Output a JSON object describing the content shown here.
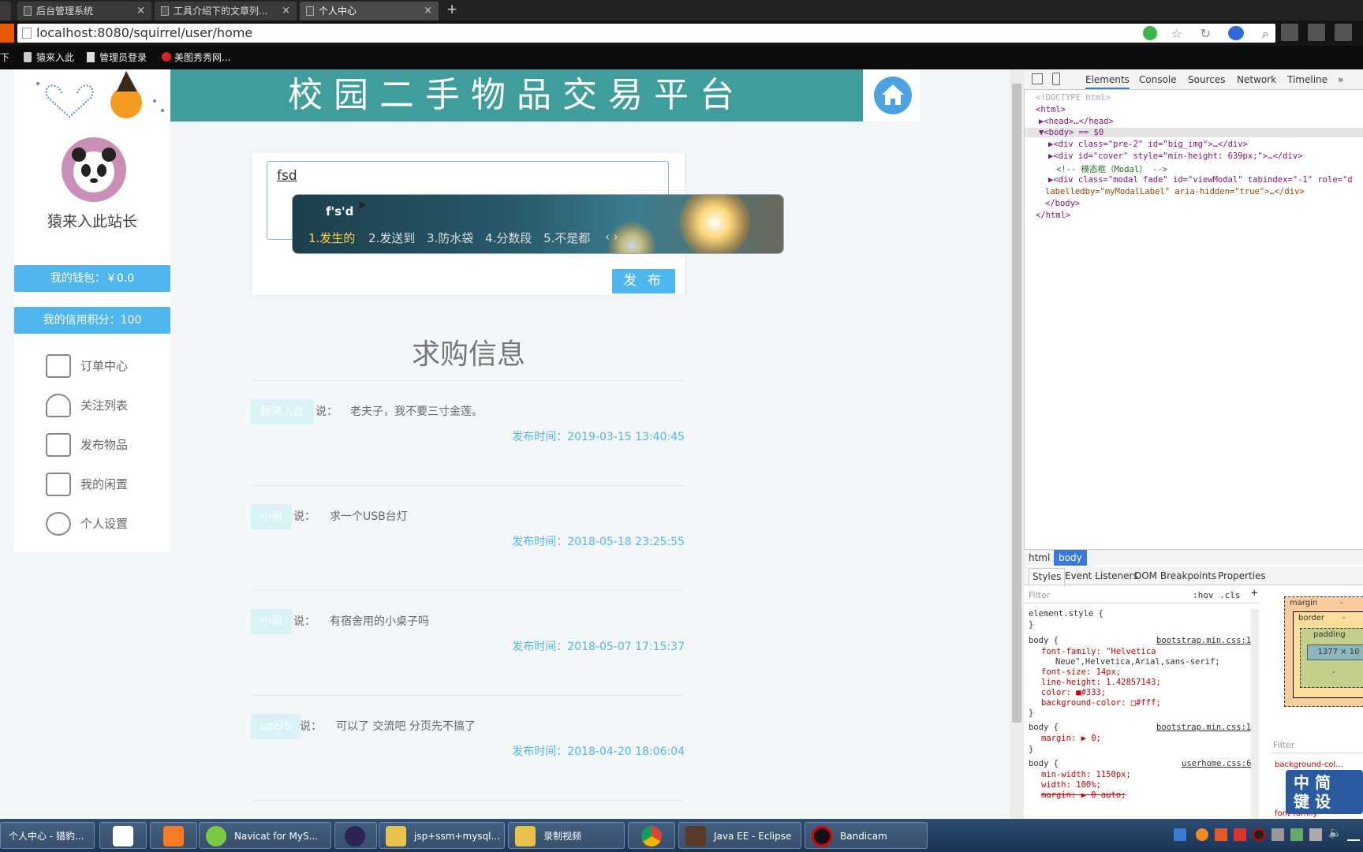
{
  "browser": {
    "tabs": [
      {
        "title": "后台管理系统",
        "active": false
      },
      {
        "title": "工具介绍下的文章列...",
        "active": false
      },
      {
        "title": "个人中心",
        "active": true
      }
    ],
    "new_tab": "+",
    "url": "localhost:8080/squirrel/user/home",
    "bookmarks": [
      "下",
      "猿来入此",
      "管理员登录",
      "美图秀秀网..."
    ]
  },
  "site": {
    "banner_title": "校园二手物品交易平台",
    "username": "猿来入此站长",
    "wallet": "我的钱包：￥0.0",
    "credit": "我的信用积分：100",
    "menu": [
      {
        "label": "订单中心",
        "icon": "envelope-icon"
      },
      {
        "label": "关注列表",
        "icon": "users-icon"
      },
      {
        "label": "发布物品",
        "icon": "bag-icon"
      },
      {
        "label": "我的闲置",
        "icon": "archive-icon"
      },
      {
        "label": "个人设置",
        "icon": "gear-icon"
      }
    ]
  },
  "post_form": {
    "input_value": "fsd",
    "submit_label": "发 布"
  },
  "ime": {
    "composition": "f's'd",
    "candidates": [
      "1.发生的",
      "2.发送到",
      "3.防水袋",
      "4.分数段",
      "5.不是都"
    ],
    "pager": "‹ ›"
  },
  "wanted": {
    "section_title": "求购信息",
    "says": "说：",
    "time_prefix": "发布时间：",
    "posts": [
      {
        "user": "猿来入此",
        "text": "老夫子，我不要三寸金莲。",
        "time": "2019-03-15 13:40:45"
      },
      {
        "user": "小丽",
        "text": "求一个USB台灯",
        "time": "2018-05-18 23:25:55"
      },
      {
        "user": "小丽",
        "text": "有宿舍用的小桌子吗",
        "time": "2018-05-07 17:15:37"
      },
      {
        "user": "user5",
        "text": "可以了 交流吧 分页先不搞了",
        "time": "2018-04-20 18:06:04"
      }
    ]
  },
  "devtools": {
    "tabs": [
      "Elements",
      "Console",
      "Sources",
      "Network",
      "Timeline",
      "»"
    ],
    "dom": [
      "<!DOCTYPE html>",
      "<html>",
      "▶<head>…</head>",
      "▼<body> == $0",
      "▶<div class=\"pre-2\" id=\"big_img\">…</div>",
      "▶<div id=\"cover\" style=\"min-height: 639px;\">…</div>",
      "<!-- 模态框（Modal） -->",
      "▶<div class=\"modal fade\" id=\"viewModal\" tabindex=\"-1\" role=\"d",
      "labelledby=\"myModalLabel\" aria-hidden=\"true\">…</div>",
      "</body>",
      "</html>"
    ],
    "breadcrumbs": [
      "html",
      "body"
    ],
    "style_tabs": [
      "Styles",
      "Event Listeners",
      "DOM Breakpoints",
      "Properties"
    ],
    "filter_placeholder": "Filter",
    "hov": ":hov",
    "cls": ".cls",
    "rules": [
      "element.style {",
      "}",
      "body {",
      "font-family: \"Helvetica",
      "Neue\",Helvetica,Arial,sans-serif;",
      "font-size: 14px;",
      "line-height: 1.42857143;",
      "color: ■#333;",
      "background-color: □#fff;",
      "}",
      "body {",
      "margin: ▶ 0;",
      "}",
      "body {",
      "min-width: 1150px;",
      "width: 100%;",
      "margin: ▶ 0 auto;"
    ],
    "rule_sources": [
      "bootstrap.min.css:14",
      "bootstrap.min.css:14",
      "userhome.css:6"
    ],
    "box_labels": [
      "margin",
      "border",
      "padding",
      "1377 × 10",
      "-",
      "-",
      "-"
    ],
    "filter2": "Filter",
    "computed": [
      "background-col...",
      "font-family"
    ]
  },
  "taskbar": {
    "items": [
      "个人中心 - 猎豹...",
      "",
      "",
      "Navicat for MyS...",
      "",
      "jsp+ssm+mysql...",
      "录制视频",
      "",
      "Java EE - Eclipse",
      "Bandicam"
    ],
    "widget_text": "中 简\n键 设"
  }
}
